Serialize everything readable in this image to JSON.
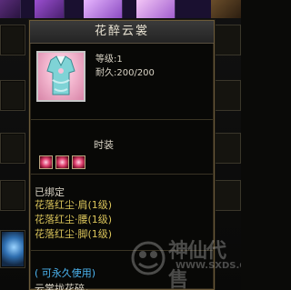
{
  "tooltip": {
    "title": "花醉云裳",
    "level": "等级:1",
    "durability": "耐久:200/200",
    "section": "时装",
    "gem_count": 3,
    "bound": "已绑定",
    "set_items": [
      "花落红尘·肩(1级)",
      "花落红尘·腰(1级)",
      "花落红尘·脚(1级)"
    ],
    "permanent": "( 可永久使用)",
    "footer": "云裳拢花碎，"
  },
  "watermark": {
    "brand": "神仙代售",
    "url": "WWW.SXDS.COM"
  },
  "colors": {
    "title_bg": "#2e2e2e",
    "border": "#6b5a3a",
    "stat_text": "#d8d2c4",
    "set_text": "#d9c35a",
    "permanent_text": "#4bb4f0",
    "gem": "#e0416f"
  }
}
